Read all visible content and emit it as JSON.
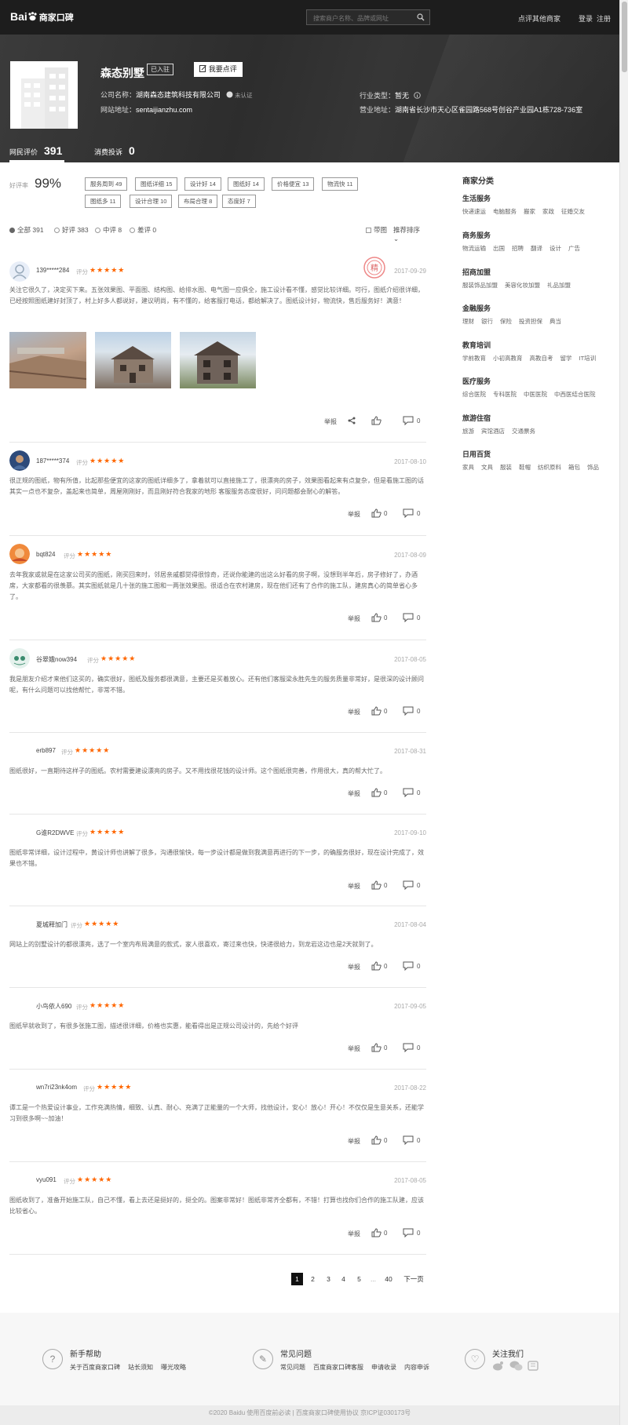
{
  "header": {
    "logo_text": "Bai",
    "logo_sub": "商家口碑",
    "search_placeholder": "搜索商户名称、品牌或网址",
    "review_others": "点评其他商家",
    "login": "登录",
    "register": "注册"
  },
  "merchant": {
    "name": "森态别墅",
    "entered_tag": "已入驻",
    "review_button": "我要点评",
    "company_label": "公司名称：",
    "company_name": "湖南森态建筑科技有限公司",
    "verify_status": "未认证",
    "website_label": "网站地址：",
    "website": "sentaijianzhu.com",
    "industry_label": "行业类型：",
    "industry": "暂无",
    "address_label": "营业地址：",
    "address": "湖南省长沙市天心区雀园路568号创谷产业园A1栋728-736室",
    "tab_reviews": "网民评价",
    "tab_reviews_count": "391",
    "tab_complaints": "消费投诉",
    "tab_complaints_count": "0"
  },
  "summary": {
    "rate_label": "好评率",
    "rate_value": "99%",
    "tags": [
      "服务周到 49",
      "图纸详细 15",
      "设计好 14",
      "图纸好 14",
      "价格便宜 13",
      "物流快 11",
      "图纸多 11",
      "设计合理 10",
      "布局合理 8",
      "态度好 7"
    ]
  },
  "filters": {
    "all": "全部 391",
    "good": "好评 383",
    "mid": "中评 8",
    "bad": "差评 0",
    "with_pic": "带图",
    "sort": "推荐排序"
  },
  "reviews": [
    {
      "user": "139*****284",
      "rating_label": "评分",
      "stars": 5,
      "date": "2017-09-29",
      "text": "关注它很久了，决定买下来。五张效果图、平面图、结构图、给排水图、电气图一应俱全，施工设计看不懂，感觉比较详细。可行，图纸介绍很详细，已经按照图纸建好封顶了，村上好多人都说好，建议明尚，有不懂的，给客服打电话，都给解决了。图纸设计好，物流快，售后服务好！满意！",
      "report": "举报",
      "likes": "",
      "comments": "0",
      "share": true
    },
    {
      "user": "187*****374",
      "rating_label": "评分",
      "stars": 5,
      "date": "2017-08-10",
      "text": "很正规的图纸，物有所值，比起那些便宜的这家的图纸详细多了，拿着就可以直接施工了，很漂亮的房子，效果图看起来有点复杂，但是看施工图的话其实一点也不复杂，盖起来也简单，周屋刚刚好，而且刚好符合我家的地形 客服服务态度很好，问问题都会耐心的解答。",
      "report": "举报",
      "likes": "0",
      "comments": "0"
    },
    {
      "user": "bqt824",
      "rating_label": "评分",
      "stars": 5,
      "date": "2017-08-09",
      "text": "去年我家或就是在这家公司买的图纸，刚买回来时，邻居亲戚都觉得很惊奇，还说你能建的出这么好看的房子啊，没想到半年后，房子修好了，办酒席，大家都看的很羡慕。其实图纸就是几十张的施工图和一两张效果图。很适合在农村建房，现在他们还有了合作的施工队，建房真心的简单省心多了。",
      "report": "举报",
      "likes": "0",
      "comments": "0"
    },
    {
      "user": "谷翠娥now394",
      "rating_label": "评分",
      "stars": 5,
      "date": "2017-08-05",
      "text": "我是朋友介绍才来他们这买的，确实很好，图纸及服务都很满意，主要还是买着放心。还有他们客服梁永胜先生的服务质量非常好，是很深的设计顾问呢，有什么问题可以找他帮忙，非常不错。",
      "report": "举报",
      "likes": "0",
      "comments": "0"
    },
    {
      "user": "erb897",
      "rating_label": "评分",
      "stars": 5,
      "date": "2017-08-31",
      "text": "图纸很好，一直期待这样子的图纸。农村需要建设漂亮的房子。又不用找很花钱的设计师。这个图纸很完善，作用很大，真的帮大忙了。",
      "report": "举报",
      "likes": "0",
      "comments": "0"
    },
    {
      "user": "G谁R2DWVE",
      "rating_label": "评分",
      "stars": 5,
      "date": "2017-09-10",
      "text": "图纸非常详细，设计过程中，黄设计师也讲解了很多，沟通很愉快，每一步设计都是做到我满意再进行的下一步，的确服务很好，现在设计完成了，效果也不错。",
      "report": "举报",
      "likes": "0",
      "comments": "0"
    },
    {
      "user": "夏城释加门",
      "rating_label": "评分",
      "stars": 5,
      "date": "2017-08-04",
      "text": "网站上的别墅设计的都很漂亮，选了一个室内布局满意的款式，家人很喜欢，寄过来也快，快递很给力，到龙岩这边也是2天就到了。",
      "report": "举报",
      "likes": "0",
      "comments": "0"
    },
    {
      "user": "小鸟依人690",
      "rating_label": "评分",
      "stars": 5,
      "date": "2017-09-05",
      "text": "图纸早就收到了，有很多张施工图，描述很详细，价格也实惠，能看得出是正规公司设计的，先给个好评",
      "report": "举报",
      "likes": "0",
      "comments": "0"
    },
    {
      "user": "wn7ri23nk4om",
      "rating_label": "评分",
      "stars": 5,
      "date": "2017-08-22",
      "text": "谭工是一个热爱设计事业，工作充满热情，细致、认真、耐心、充满了正能量的一个大师，找他设计，安心！放心！开心！不仅仅是生意关系，还能学习到很多啊~~加油！",
      "report": "举报",
      "likes": "0",
      "comments": "0"
    },
    {
      "user": "vyu091",
      "rating_label": "评分",
      "stars": 5,
      "date": "2017-08-05",
      "text": "图纸收到了，准备开始施工队，自己不懂，看上去还是挺好的，挺全的。图案非常好！图纸非常齐全都有，不错！打算也找你们合作的施工队建，应该比较省心。",
      "report": "举报",
      "likes": "0",
      "comments": "0"
    }
  ],
  "pagination": {
    "pages": [
      "1",
      "2",
      "3",
      "4",
      "5",
      "...",
      "40"
    ],
    "next": "下一页",
    "current": "1"
  },
  "sidebar": {
    "title": "商家分类",
    "categories": [
      {
        "name": "生活服务",
        "items": [
          "快递速运",
          "电脑服务",
          "搬家",
          "家政",
          "征婚交友"
        ]
      },
      {
        "name": "商务服务",
        "items": [
          "物流运输",
          "出国",
          "招聘",
          "翻译",
          "设计",
          "广告"
        ]
      },
      {
        "name": "招商加盟",
        "items": [
          "服装饰品加盟",
          "美容化妆加盟",
          "礼品加盟"
        ]
      },
      {
        "name": "金融服务",
        "items": [
          "理财",
          "银行",
          "保险",
          "投资担保",
          "典当"
        ]
      },
      {
        "name": "教育培训",
        "items": [
          "学前教育",
          "小初高教育",
          "高教自考",
          "留学",
          "IT培训"
        ]
      },
      {
        "name": "医疗服务",
        "items": [
          "综合医院",
          "专科医院",
          "中医医院",
          "中西医结合医院"
        ]
      },
      {
        "name": "旅游住宿",
        "items": [
          "旅游",
          "宾馆酒店",
          "交通票务"
        ]
      },
      {
        "name": "日用百货",
        "items": [
          "家具",
          "文具",
          "服装",
          "鞋帽",
          "纺织原料",
          "箱包",
          "饰品"
        ]
      }
    ]
  },
  "footer": {
    "help_title": "新手帮助",
    "help_links": [
      "关于百度商家口碑",
      "站长须知",
      "曝光攻略"
    ],
    "faq_title": "常见问题",
    "faq_links": [
      "常见问题",
      "百度商家口碑客服",
      "申请收录",
      "内容申诉"
    ],
    "follow_title": "关注我们",
    "copyright": "©2020 Baidu 使用百度前必读 | 百度商家口碑使用协议 京ICP证030173号"
  },
  "colors": {
    "star": "#ff6600",
    "header_bg": "#1d1d1d",
    "banner_bg": "#333333"
  }
}
